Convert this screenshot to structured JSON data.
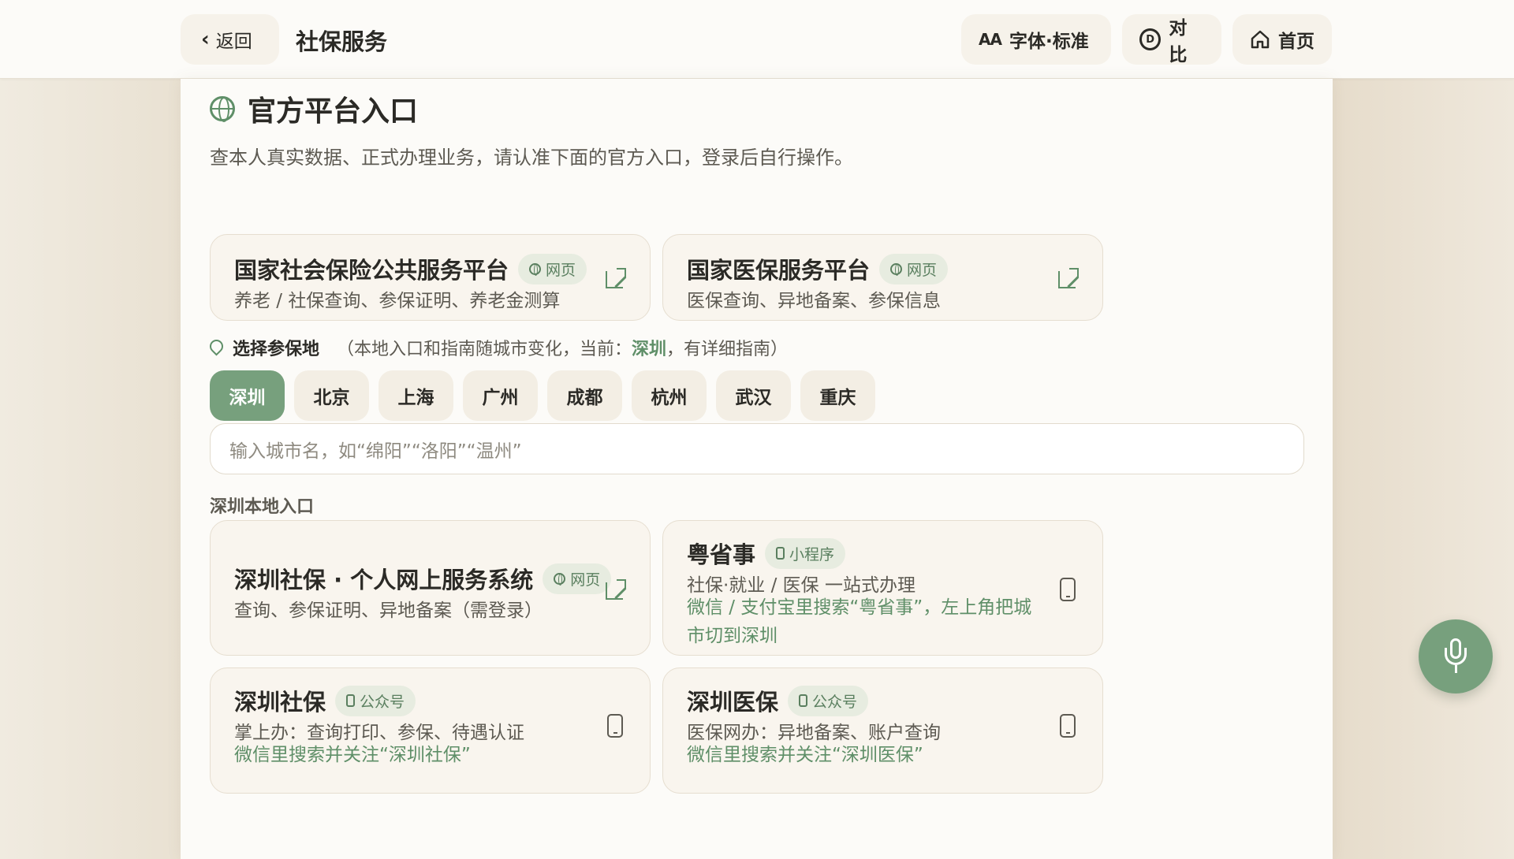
{
  "header": {
    "back_label": "返回",
    "title": "社保服务",
    "font_prefix": "AA",
    "font_label": "字体·标准",
    "contrast_label": "对比",
    "home_label": "首页"
  },
  "section": {
    "title": "官方平台入口",
    "desc": "查本人真实数据、正式办理业务，请认准下面的官方入口，登录后自行操作。"
  },
  "national": [
    {
      "title": "国家社会保险公共服务平台",
      "tag": "网页",
      "sub": "养老 / 社保查询、参保证明、养老金测算"
    },
    {
      "title": "国家医保服务平台",
      "tag": "网页",
      "sub": "医保查询、异地备案、参保信息"
    }
  ],
  "location": {
    "label": "选择参保地",
    "note_prefix": "（本地入口和指南随城市变化，当前：",
    "current": "深圳",
    "note_suffix": "，有详细指南）"
  },
  "cities": [
    "深圳",
    "北京",
    "上海",
    "广州",
    "成都",
    "杭州",
    "武汉",
    "重庆"
  ],
  "search": {
    "placeholder": "输入城市名，如“绵阳”“洛阳”“温州”"
  },
  "local": {
    "heading": "深圳本地入口",
    "cards": [
      {
        "title": "深圳社保 · 个人网上服务系统",
        "tag": "网页",
        "sub": "查询、参保证明、异地备案（需登录）"
      },
      {
        "title": "粤省事",
        "tag": "小程序",
        "sub": "社保·就业 / 医保 一站式办理",
        "hint": "微信 / 支付宝里搜索“粤省事”，左上角把城市切到深圳"
      },
      {
        "title": "深圳社保",
        "tag": "公众号",
        "sub": "掌上办：查询打印、参保、待遇认证",
        "hint": "微信里搜索并关注“深圳社保”"
      },
      {
        "title": "深圳医保",
        "tag": "公众号",
        "sub": "医保网办：异地备案、账户查询",
        "hint": "微信里搜索并关注“深圳医保”"
      }
    ]
  },
  "icons": {
    "back": "chevron-left-icon",
    "contrast": "contrast-icon",
    "home": "home-icon",
    "globe": "globe-icon",
    "external": "external-link-icon",
    "phone": "phone-icon",
    "pin": "location-pin-icon",
    "mic": "microphone-icon"
  },
  "colors": {
    "accent": "#77a07d",
    "accent_text": "#5f8f68",
    "background": "#efe9dd",
    "panel": "#fcfbf8",
    "card": "#f9f5ee"
  }
}
